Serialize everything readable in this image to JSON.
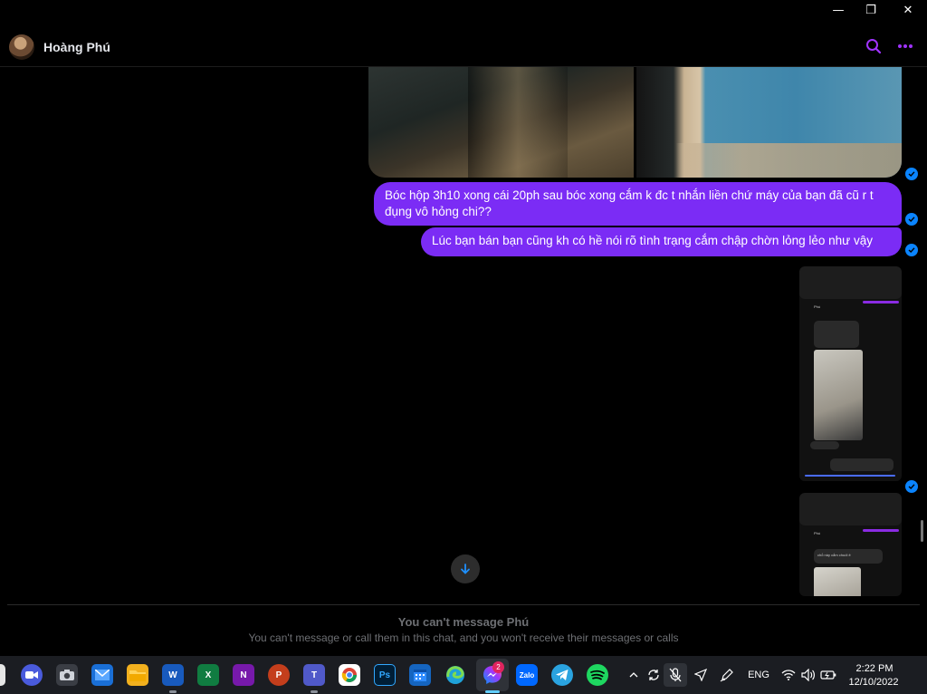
{
  "window": {
    "minimize_label": "—",
    "restore_label": "❐",
    "close_label": "✕"
  },
  "header": {
    "contact_name": "Hoàng Phú",
    "accent_color": "#a033ff"
  },
  "messages": [
    {
      "type": "photos",
      "from": "me",
      "count": 2
    },
    {
      "type": "text",
      "from": "me",
      "text": "Bóc hộp 3h10 xong cái 20ph sau bóc xong cắm k đc t nhắn liền chứ máy của bạn đã cũ r t đụng vô hỏng chi??"
    },
    {
      "type": "text",
      "from": "me",
      "text": "Lúc bạn bán bạn cũng kh có hề nói rõ tình trạng cắm chập chờn lỏng lẻo như vậy"
    },
    {
      "type": "screenshot",
      "from": "me"
    },
    {
      "type": "screenshot",
      "from": "me"
    }
  ],
  "mini_shot": {
    "name": "Phú",
    "caption": "chỗ này cắm chuối ê"
  },
  "notice": {
    "title": "You can't message Phú",
    "subtitle": "You can't message or call them in this chat, and you won't receive their messages or calls"
  },
  "taskbar": {
    "apps": [
      "zoom",
      "camera",
      "mail",
      "file-explorer",
      "word",
      "excel",
      "onenote",
      "powerpoint",
      "teams",
      "chrome",
      "photoshop",
      "calendar",
      "edge",
      "messenger",
      "zalo",
      "telegram",
      "spotify"
    ],
    "word_label": "W",
    "excel_label": "X",
    "onenote_label": "N",
    "powerpoint_label": "P",
    "teams_label": "T",
    "photoshop_label": "Ps",
    "zalo_label": "Zalo",
    "messenger_badge": "2",
    "language": "ENG",
    "time": "2:22 PM",
    "date": "12/10/2022"
  }
}
